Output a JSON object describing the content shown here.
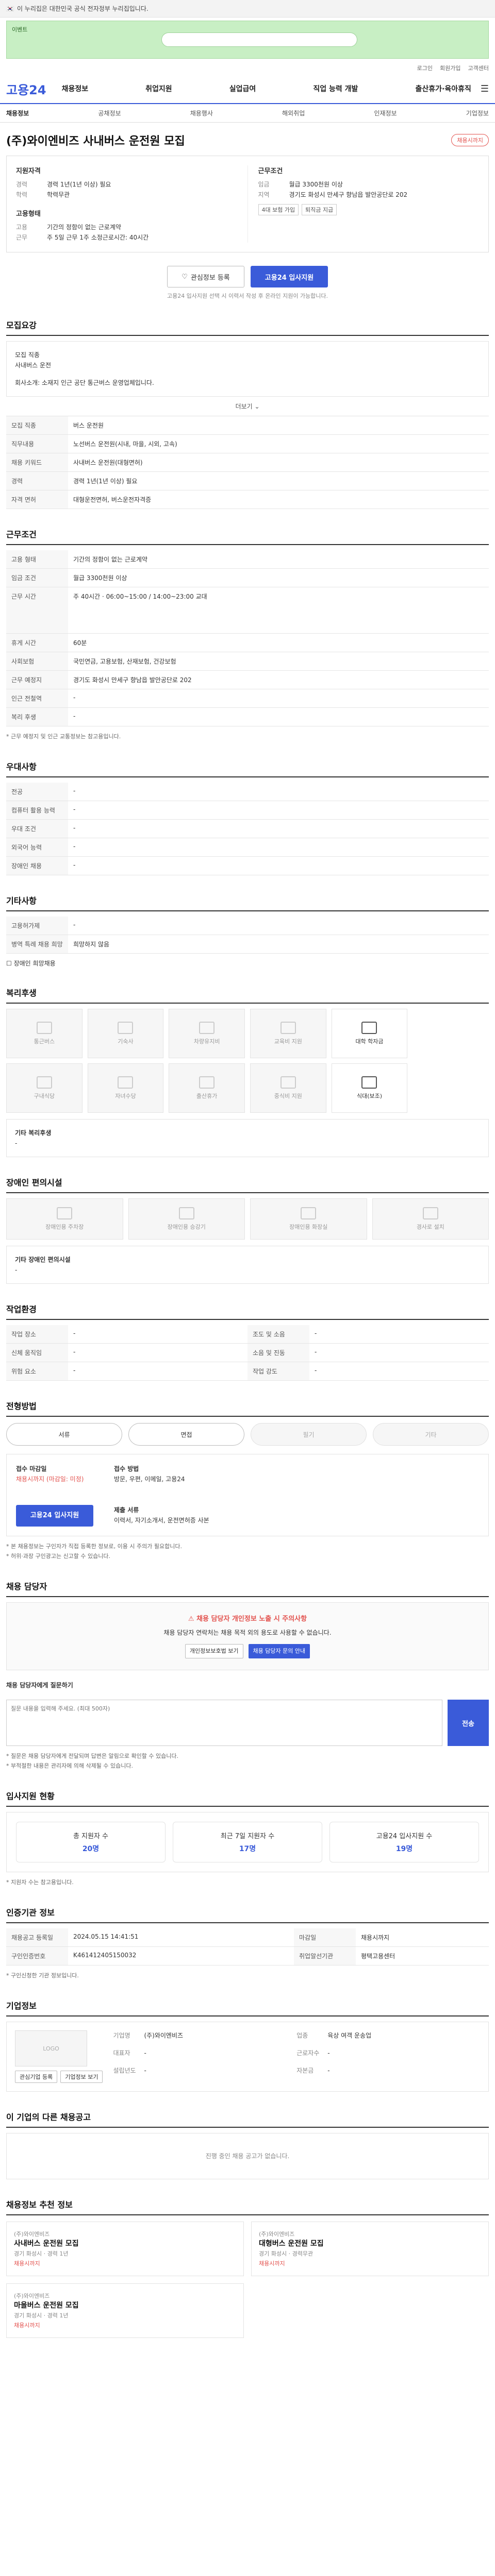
{
  "topbar": {
    "text": "이 누리집은 대한민국 공식 전자정부 누리집입니다."
  },
  "banner": {
    "text": "이벤트"
  },
  "util": [
    "로그인",
    "회원가입",
    "고객센터"
  ],
  "gnb": {
    "logo": "고용24",
    "menu": [
      "채용정보",
      "취업지원",
      "실업급여",
      "직업 능력 개발",
      "출산휴가·육아휴직"
    ]
  },
  "subnav": [
    "채용정보",
    "공채정보",
    "채용행사",
    "해외취업",
    "인재정보",
    "기업정보"
  ],
  "job": {
    "title": "(주)와이엔비즈 사내버스 운전원 모집",
    "status": "채용시까지",
    "recruit_h": "지원자격",
    "recruit": [
      {
        "k": "경력",
        "v": "경력 1년(1년 이상) 필요"
      },
      {
        "k": "학력",
        "v": "학력무관"
      }
    ],
    "worktype_h": "고용형태",
    "worktype": [
      {
        "k": "고용",
        "v": "기간의 정함이 없는 근로계약"
      },
      {
        "k": "근무",
        "v": "주 5일 근무 1주 소정근로시간: 40시간"
      }
    ],
    "cond_h": "근무조건",
    "cond": [
      {
        "k": "임금",
        "v": "월급 3300천원 이상"
      },
      {
        "k": "지역",
        "v": "경기도 화성시 만세구 향남읍 발안공단로 202"
      }
    ],
    "tags": [
      "4대 보험 가입",
      "퇴직금 지급"
    ]
  },
  "actions": {
    "interest": "관심정보 등록",
    "apply": "고용24 입사지원",
    "notice": "고용24 입사지원 선택 시 이력서 작성 후 온라인 지원이 가능합니다."
  },
  "s_detail": {
    "title": "모집요강",
    "lines": [
      "모집 직종",
      "사내버스 운전",
      "",
      "회사소개: 소재지 인근 공단 통근버스 운영업체입니다."
    ],
    "more": "더보기",
    "rows": [
      {
        "k": "모집 직종",
        "v": "버스 운전원"
      },
      {
        "k": "직무내용",
        "v": "노선버스 운전원(시내, 마을, 시외, 고속)"
      },
      {
        "k": "채용 키워드",
        "v": "사내버스 운전원(대형면허)"
      },
      {
        "k": "경력",
        "v": "경력 1년(1년 이상) 필요"
      },
      {
        "k": "자격 면허",
        "v": "대형운전면허, 버스운전자격증"
      }
    ]
  },
  "s_work": {
    "title": "근무조건",
    "rows": [
      {
        "k": "고용 형태",
        "v": "기간의 정함이 없는 근로계약"
      },
      {
        "k": "임금 조건",
        "v": "월급 3300천원 이상"
      },
      {
        "k": "근무 시간",
        "v": "주 40시간 · 06:00~15:00 / 14:00~23:00 교대"
      },
      {
        "k": "휴게 시간",
        "v": "60분"
      },
      {
        "k": "사회보험",
        "v": "국민연금, 고용보험, 산재보험, 건강보험"
      },
      {
        "k": "근무 예정지",
        "v": "경기도 화성시 만세구 향남읍 발안공단로 202"
      },
      {
        "k": "인근 전철역",
        "v": "-"
      },
      {
        "k": "복리 후생",
        "v": "-"
      }
    ],
    "note": "* 근무 예정지 및 인근 교통정보는 참고용입니다."
  },
  "s_pref": {
    "title": "우대사항",
    "rows": [
      {
        "k": "전공",
        "v": "-"
      },
      {
        "k": "컴퓨터 활용 능력",
        "v": "-"
      },
      {
        "k": "우대 조건",
        "v": "-"
      },
      {
        "k": "외국어 능력",
        "v": "-"
      },
      {
        "k": "장애인 채용",
        "v": "-"
      }
    ]
  },
  "s_etc": {
    "title": "기타사항",
    "rows": [
      {
        "k": "고용허가제",
        "v": "-"
      },
      {
        "k": "병역 특례 채용 희망",
        "v": "희망하지 않음"
      }
    ],
    "check": "장애인 희망채용"
  },
  "s_welfare": {
    "title": "복리후생",
    "items": [
      "통근버스",
      "기숙사",
      "차량유지비",
      "교육비 지원",
      "대학 학자금",
      "",
      "구내식당",
      "자녀수당",
      "출산휴가",
      "중식비 지원",
      "식대(보조)"
    ],
    "etc_h": "기타 복리후생",
    "etc": "-"
  },
  "s_disabled": {
    "title": "장애인 편의시설",
    "items": [
      "장애인용 주차장",
      "장애인용 승강기",
      "장애인용 화장실",
      "경사로 설치"
    ],
    "etc_h": "기타 장애인 편의시설",
    "etc": "-"
  },
  "s_env": {
    "title": "작업환경",
    "rows": [
      {
        "k": "작업 장소",
        "v": "-"
      },
      {
        "k": "조도 및 소음",
        "v": "-"
      },
      {
        "k": "신체 움직임",
        "v": "-"
      },
      {
        "k": "소음 및 진동",
        "v": "-"
      },
      {
        "k": "위험 요소",
        "v": "-"
      },
      {
        "k": "작업 강도",
        "v": "-"
      }
    ]
  },
  "s_process": {
    "title": "전형방법",
    "steps": [
      "서류",
      "면접",
      "필기",
      "기타"
    ],
    "deadline_h": "접수 마감일",
    "deadline": "채용시까지 (마감일: 미정)",
    "method_h": "접수 방법",
    "method": "방문, 우편, 이메일, 고용24",
    "docs_h": "제출 서류",
    "docs": "이력서, 자기소개서, 운전면허증 사본",
    "apply_btn": "고용24 입사지원",
    "bullets": [
      "* 본 채용정보는 구인자가 직접 등록한 정보로, 이용 시 주의가 필요합니다.",
      "* 허위·과장 구인광고는 신고할 수 있습니다."
    ]
  },
  "s_contact": {
    "title": "채용 담당자",
    "alert_t": "채용 담당자 개인정보 노출 시 주의사항",
    "alert_b": "채용 담당자 연락처는 채용 목적 외의 용도로 사용할 수 없습니다.",
    "btn1": "개인정보보호법 보기",
    "btn2": "채용 담당자 문의 안내",
    "qa_label": "채용 담당자에게 질문하기",
    "qa_placeholder": "질문 내용을 입력해 주세요. (최대 500자)",
    "qa_send": "전송",
    "bullets": [
      "* 질문은 채용 담당자에게 전달되며 답변은 알림으로 확인할 수 있습니다.",
      "* 부적절한 내용은 관리자에 의해 삭제될 수 있습니다."
    ]
  },
  "s_stats": {
    "title": "입사지원 현황",
    "items": [
      {
        "label": "총 지원자 수",
        "value": "20명"
      },
      {
        "label": "최근 7일 지원자 수",
        "value": "17명"
      },
      {
        "label": "고용24 입사지원 수",
        "value": "19명"
      }
    ],
    "note": "* 지원자 수는 참고용입니다."
  },
  "s_agency": {
    "title": "인증기관 정보",
    "rows": [
      {
        "k": "채용공고 등록일",
        "v": "2024.05.15 14:41:51",
        "k2": "마감일",
        "v2": "채용시까지"
      },
      {
        "k": "구인인증번호",
        "v": "K461412405150032",
        "k2": "취업알선기관",
        "v2": "평택고용센터"
      }
    ],
    "note": "* 구인신청한 기관 정보입니다."
  },
  "s_company": {
    "title": "기업정보",
    "logo": "LOGO",
    "info": [
      {
        "k": "기업명",
        "v": "(주)와이엔비즈"
      },
      {
        "k": "업종",
        "v": "육상 여객 운송업"
      },
      {
        "k": "대표자",
        "v": "-"
      },
      {
        "k": "근로자수",
        "v": "-"
      },
      {
        "k": "설립년도",
        "v": "-"
      },
      {
        "k": "자본금",
        "v": "-"
      }
    ],
    "btn1": "관심기업 등록",
    "btn2": "기업정보 보기"
  },
  "s_other": {
    "title": "이 기업의 다른 채용공고",
    "empty": "진행 중인 채용 공고가 없습니다."
  },
  "s_recommend": {
    "title": "채용정보 추천 정보",
    "cards": [
      {
        "org": "(주)와이엔비즈",
        "title": "사내버스 운전원 모집",
        "sub": "경기 화성시 · 경력 1년",
        "tag": "채용시까지"
      },
      {
        "org": "(주)와이엔비즈",
        "title": "대형버스 운전원 모집",
        "sub": "경기 화성시 · 경력무관",
        "tag": "채용시까지"
      },
      {
        "org": "(주)와이엔비즈",
        "title": "마을버스 운전원 모집",
        "sub": "경기 화성시 · 경력 1년",
        "tag": "채용시까지"
      }
    ]
  }
}
